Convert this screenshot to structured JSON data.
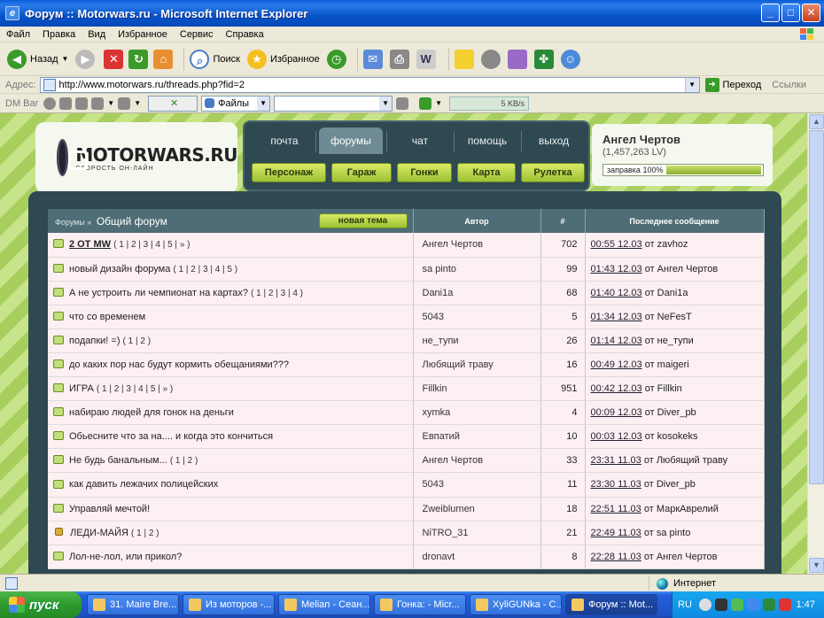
{
  "window": {
    "title": "Форум :: Motorwars.ru - Microsoft Internet Explorer",
    "app_icon": "e",
    "minimize": "_",
    "maximize": "□",
    "close": "✕"
  },
  "menu": [
    "Файл",
    "Правка",
    "Вид",
    "Избранное",
    "Сервис",
    "Справка"
  ],
  "toolbar": {
    "back": "Назад",
    "search": "Поиск",
    "favorites": "Избранное"
  },
  "address": {
    "label": "Адрес:",
    "url": "http://www.motorwars.ru/threads.php?fid=2",
    "go": "Переход",
    "links": "Ссылки"
  },
  "dmbar": {
    "label": "DM Bar",
    "files": "Файлы",
    "speed": "5 KB/s"
  },
  "site": {
    "brand": "MOTORWARS.RU",
    "slogan": "скорость он-лайн",
    "nav_tabs": [
      "почта",
      "форумы",
      "чат",
      "помощь",
      "выход"
    ],
    "nav_buttons": [
      "Персонаж",
      "Гараж",
      "Гонки",
      "Карта",
      "Рулетка"
    ],
    "user": {
      "name": "Ангел Чертов",
      "lv": "(1,457,263 LV)",
      "fuel_label": "заправка 100%",
      "fuel_percent": 100
    }
  },
  "forum": {
    "breadcrumb": "Форумы »",
    "title": "Общий форум",
    "new_topic": "новая тема",
    "columns": {
      "author": "Автор",
      "count": "#",
      "last": "Последнее сообщение"
    },
    "threads": [
      {
        "title": "2 ОТ MW",
        "pages": "( 1 | 2 | 3 | 4 | 5 | » )",
        "author": "Ангел Чертов",
        "count": "702",
        "date": "00:55 12.03",
        "by": "от zavhoz"
      },
      {
        "title": "новый дизайн форума",
        "pages": "( 1 | 2 | 3 | 4 | 5 )",
        "author": "sa pinto",
        "count": "99",
        "date": "01:43 12.03",
        "by": "от Ангел Чертов"
      },
      {
        "title": "А не устроить ли чемпионат на картах?",
        "pages": "( 1 | 2 | 3 | 4 )",
        "author": "Dani1a",
        "count": "68",
        "date": "01:40 12.03",
        "by": "от Dani1a"
      },
      {
        "title": "что со временем",
        "pages": "",
        "author": "5043",
        "count": "5",
        "date": "01:34 12.03",
        "by": "от NeFesT"
      },
      {
        "title": "подапки! =)",
        "pages": "( 1 | 2 )",
        "author": "не_тупи",
        "count": "26",
        "date": "01:14 12.03",
        "by": "от не_тупи"
      },
      {
        "title": "до каких пор нас будут кормить обещаниями???",
        "pages": "",
        "author": "Любящий траву",
        "count": "16",
        "date": "00:49 12.03",
        "by": "от maigeri"
      },
      {
        "title": "ИГРА",
        "pages": "( 1 | 2 | 3 | 4 | 5 | » )",
        "author": "Fillkin",
        "count": "951",
        "date": "00:42 12.03",
        "by": "от Fillkin"
      },
      {
        "title": "набираю людей для гонок на деньги",
        "pages": "",
        "author": "xymka",
        "count": "4",
        "date": "00:09 12.03",
        "by": "от Diver_pb"
      },
      {
        "title": "Обьесните что за на.... и когда это кончиться",
        "pages": "",
        "author": "Евпатий",
        "count": "10",
        "date": "00:03 12.03",
        "by": "от kosokeks"
      },
      {
        "title": "Не будь банальным...",
        "pages": "( 1 | 2 )",
        "author": "Ангел Чертов",
        "count": "33",
        "date": "23:31 11.03",
        "by": "от Любящий траву"
      },
      {
        "title": "как давить лежачих полицейских",
        "pages": "",
        "author": "5043",
        "count": "11",
        "date": "23:30 11.03",
        "by": "от Diver_pb"
      },
      {
        "title": "Управляй мечтой!",
        "pages": "",
        "author": "Zweiblumen",
        "count": "18",
        "date": "22:51 11.03",
        "by": "от МаркАврелий"
      },
      {
        "title": "ЛЕДИ-МАЙЯ",
        "pages": "( 1 | 2 )",
        "author": "NiTRO_31",
        "count": "21",
        "date": "22:49 11.03",
        "by": "от sa pinto"
      },
      {
        "title": "Лол-не-лол, или прикол?",
        "pages": "",
        "author": "dronavt",
        "count": "8",
        "date": "22:28 11.03",
        "by": "от Ангел Чертов"
      }
    ]
  },
  "status": {
    "zone": "Интернет"
  },
  "taskbar": {
    "start": "пуск",
    "tasks": [
      "31. Maire Bre...",
      "Из моторов -...",
      "Melian - Сеан...",
      "Гонка: - Micr...",
      "XyliGUNka - C...",
      "Форум :: Mot..."
    ],
    "lang": "RU",
    "clock": "1:47"
  },
  "colors": {
    "nav_panel": "#2f4953",
    "button_green": "#9cc233",
    "row_bg": "#fdf0f2",
    "header_bg": "#4f6d76",
    "page_bg_green": "#a8cf5e"
  }
}
